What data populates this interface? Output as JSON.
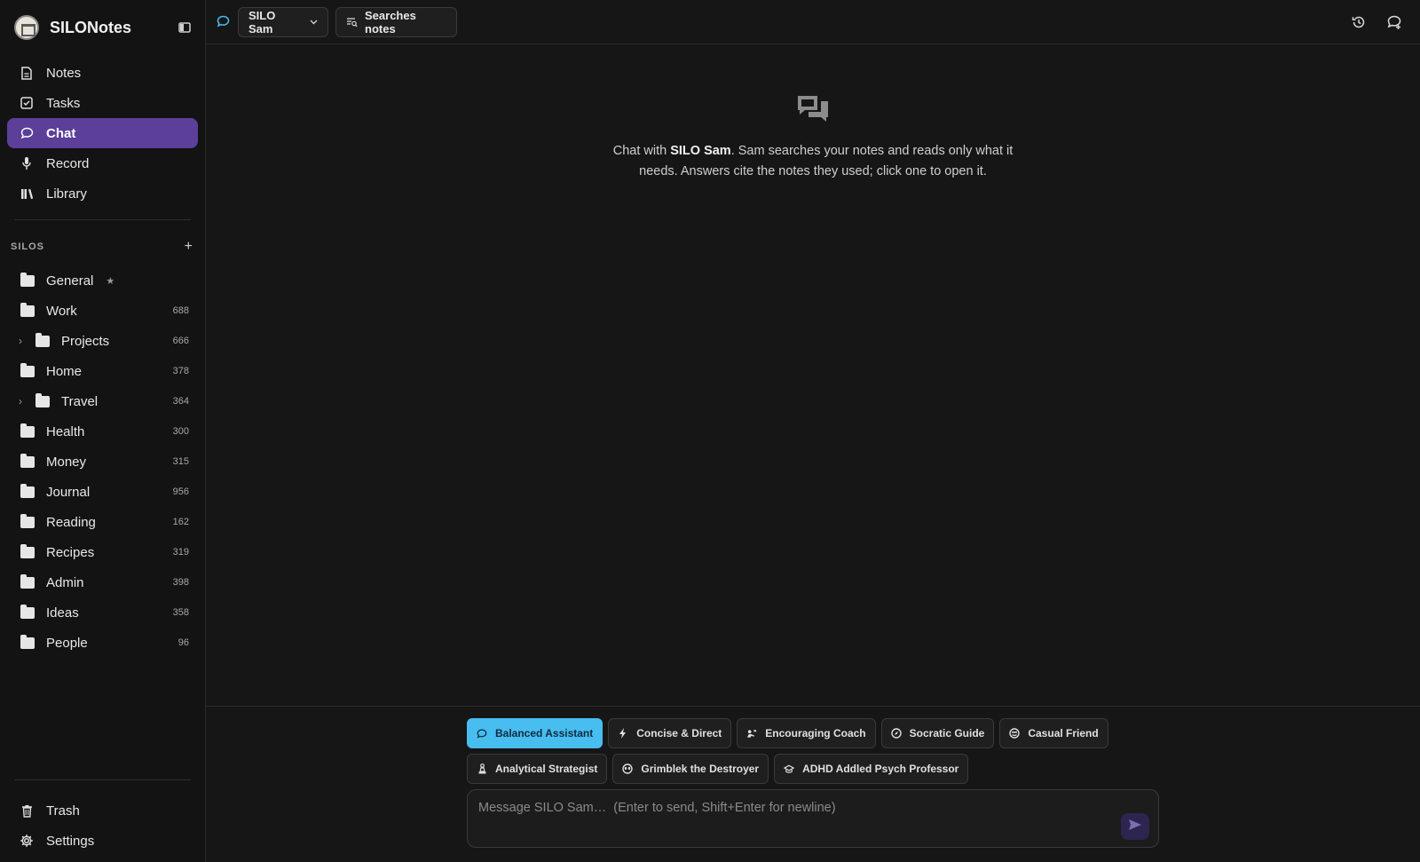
{
  "brand": {
    "name": "SILONotes"
  },
  "nav": [
    {
      "label": "Notes",
      "icon": "note-icon"
    },
    {
      "label": "Tasks",
      "icon": "checkbox-icon"
    },
    {
      "label": "Chat",
      "icon": "chat-bubble-icon",
      "active": true
    },
    {
      "label": "Record",
      "icon": "microphone-icon"
    },
    {
      "label": "Library",
      "icon": "library-icon"
    }
  ],
  "silos": {
    "title": "SILOS",
    "add_label": "+",
    "items": [
      {
        "label": "General",
        "count": "",
        "starred": true,
        "child": false
      },
      {
        "label": "Work",
        "count": "688",
        "child": false
      },
      {
        "label": "Projects",
        "count": "666",
        "child": true
      },
      {
        "label": "Home",
        "count": "378",
        "child": false
      },
      {
        "label": "Travel",
        "count": "364",
        "child": true
      },
      {
        "label": "Health",
        "count": "300",
        "child": false
      },
      {
        "label": "Money",
        "count": "315",
        "child": false
      },
      {
        "label": "Journal",
        "count": "956",
        "child": false
      },
      {
        "label": "Reading",
        "count": "162",
        "child": false
      },
      {
        "label": "Recipes",
        "count": "319",
        "child": false
      },
      {
        "label": "Admin",
        "count": "398",
        "child": false
      },
      {
        "label": "Ideas",
        "count": "358",
        "child": false
      },
      {
        "label": "People",
        "count": "96",
        "child": false
      }
    ]
  },
  "bottom_nav": [
    {
      "label": "Trash",
      "icon": "trash-icon"
    },
    {
      "label": "Settings",
      "icon": "gear-icon"
    }
  ],
  "topbar": {
    "assistant_label": "SILO Sam",
    "search_mode_label": "Searches notes"
  },
  "empty_state": {
    "prefix": "Chat with ",
    "bold": "SILO Sam",
    "suffix": ". Sam searches your notes and reads only what it needs. Answers cite the notes they used; click one to open it."
  },
  "personas": {
    "row1": [
      {
        "label": "Balanced Assistant",
        "icon": "chat-bubble-icon",
        "active": true
      },
      {
        "label": "Concise & Direct",
        "icon": "lightning-icon"
      },
      {
        "label": "Encouraging Coach",
        "icon": "coach-icon"
      },
      {
        "label": "Socratic Guide",
        "icon": "compass-icon"
      },
      {
        "label": "Casual Friend",
        "icon": "smile-icon"
      }
    ],
    "row2": [
      {
        "label": "Analytical Strategist",
        "icon": "chess-icon"
      },
      {
        "label": "Grimblek the Destroyer",
        "icon": "alien-icon"
      },
      {
        "label": "ADHD Addled Psych Professor",
        "icon": "graduation-cap-icon"
      }
    ]
  },
  "composer": {
    "placeholder": "Message SILO Sam…  (Enter to send, Shift+Enter for newline)"
  },
  "colors": {
    "accent": "#5b3f99",
    "persona_active": "#48bdf0",
    "chat_icon": "#48bdf0"
  }
}
